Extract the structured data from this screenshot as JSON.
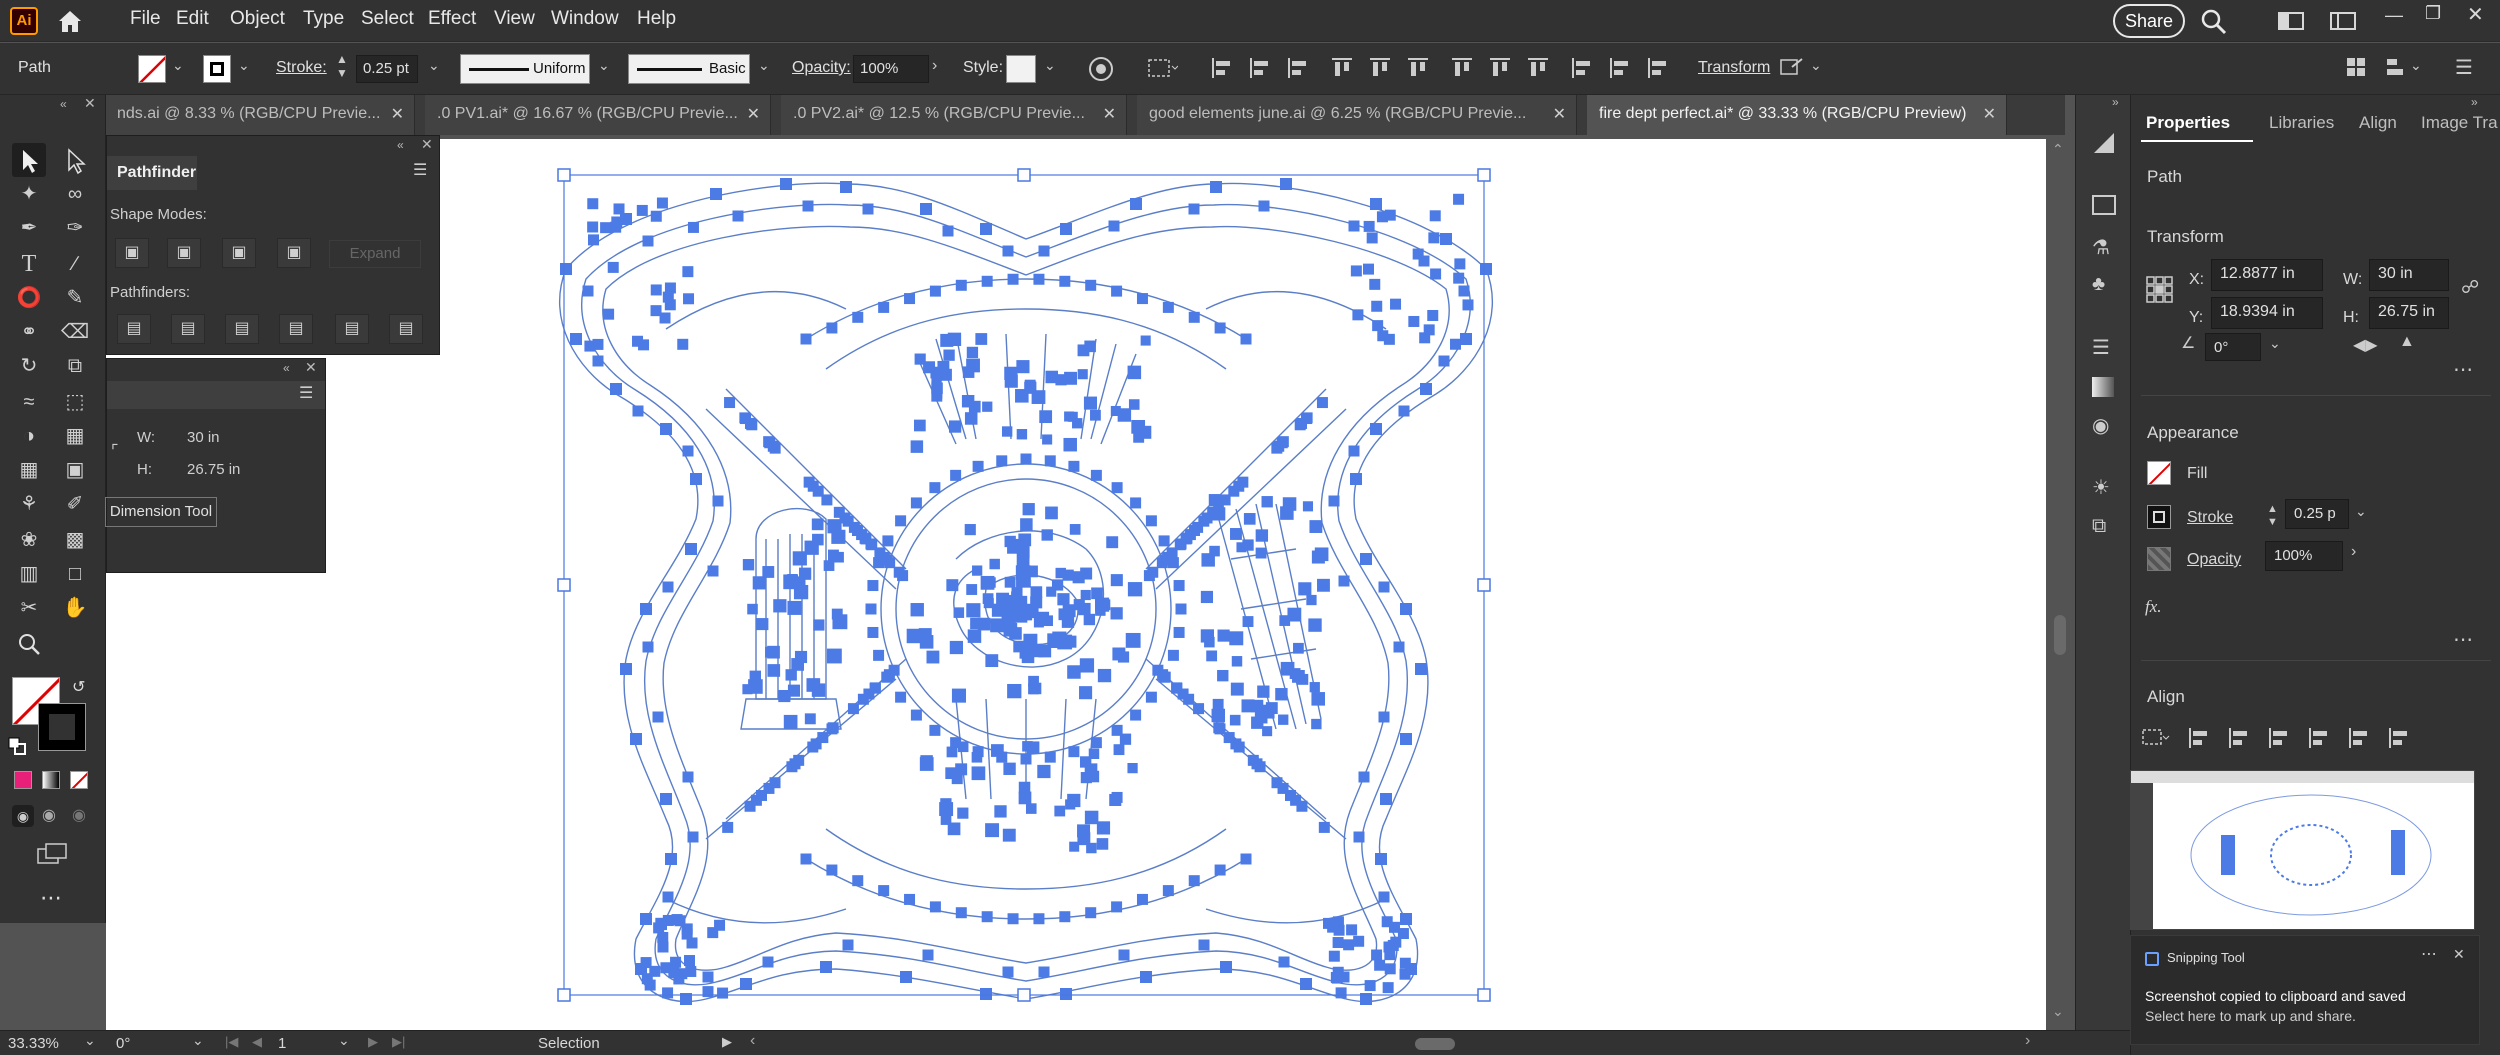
{
  "app": {
    "logo": "Ai",
    "accent": "#ff9a00",
    "selection_color": "#4d7be6"
  },
  "menu": [
    "File",
    "Edit",
    "Object",
    "Type",
    "Select",
    "Effect",
    "View",
    "Window",
    "Help"
  ],
  "menubar_right": {
    "share": "Share"
  },
  "control": {
    "object_type": "Path",
    "stroke_label": "Stroke:",
    "stroke_value": "0.25 pt",
    "profile_uniform": "Uniform",
    "brush_basic": "Basic",
    "opacity_label": "Opacity:",
    "opacity_value": "100%",
    "style_label": "Style:",
    "transform_link": "Transform"
  },
  "tabs": [
    {
      "label": "nds.ai @ 8.33 % (RGB/CPU Previe...",
      "active": false
    },
    {
      "label": ".0 PV1.ai* @ 16.67 % (RGB/CPU Previe...",
      "active": false
    },
    {
      "label": ".0 PV2.ai* @ 12.5 % (RGB/CPU Previe...",
      "active": false
    },
    {
      "label": "good elements june.ai @ 6.25 % (RGB/CPU Previe...",
      "active": false
    },
    {
      "label": "fire dept perfect.ai* @ 33.33 % (RGB/CPU Preview)",
      "active": true
    }
  ],
  "pathfinder": {
    "tab": "Pathfinder",
    "shape_modes": "Shape Modes:",
    "expand": "Expand",
    "pathfinders": "Pathfinders:"
  },
  "dimension_panel": {
    "w_label": "W:",
    "w_value": "30 in",
    "h_label": "H:",
    "h_value": "26.75 in",
    "tool_button": "Dimension Tool"
  },
  "properties": {
    "tabs": [
      "Properties",
      "Libraries",
      "Align",
      "Image Tra"
    ],
    "object": "Path",
    "transform_title": "Transform",
    "x_label": "X:",
    "x_value": "12.8877 in",
    "y_label": "Y:",
    "y_value": "18.9394 in",
    "w_label": "W:",
    "w_value": "30 in",
    "h_label": "H:",
    "h_value": "26.75 in",
    "angle_value": "0°",
    "appearance_title": "Appearance",
    "fill_label": "Fill",
    "stroke_label": "Stroke",
    "stroke_value": "0.25 p",
    "opacity_label": "Opacity",
    "opacity_value": "100%",
    "fx": "fx.",
    "align_title": "Align"
  },
  "status": {
    "zoom": "33.33%",
    "rotation": "0°",
    "artboard": "1",
    "tool": "Selection"
  },
  "toast": {
    "app": "Snipping Tool",
    "title": "Screenshot copied to clipboard and saved",
    "body": "Select here to mark up and share."
  }
}
